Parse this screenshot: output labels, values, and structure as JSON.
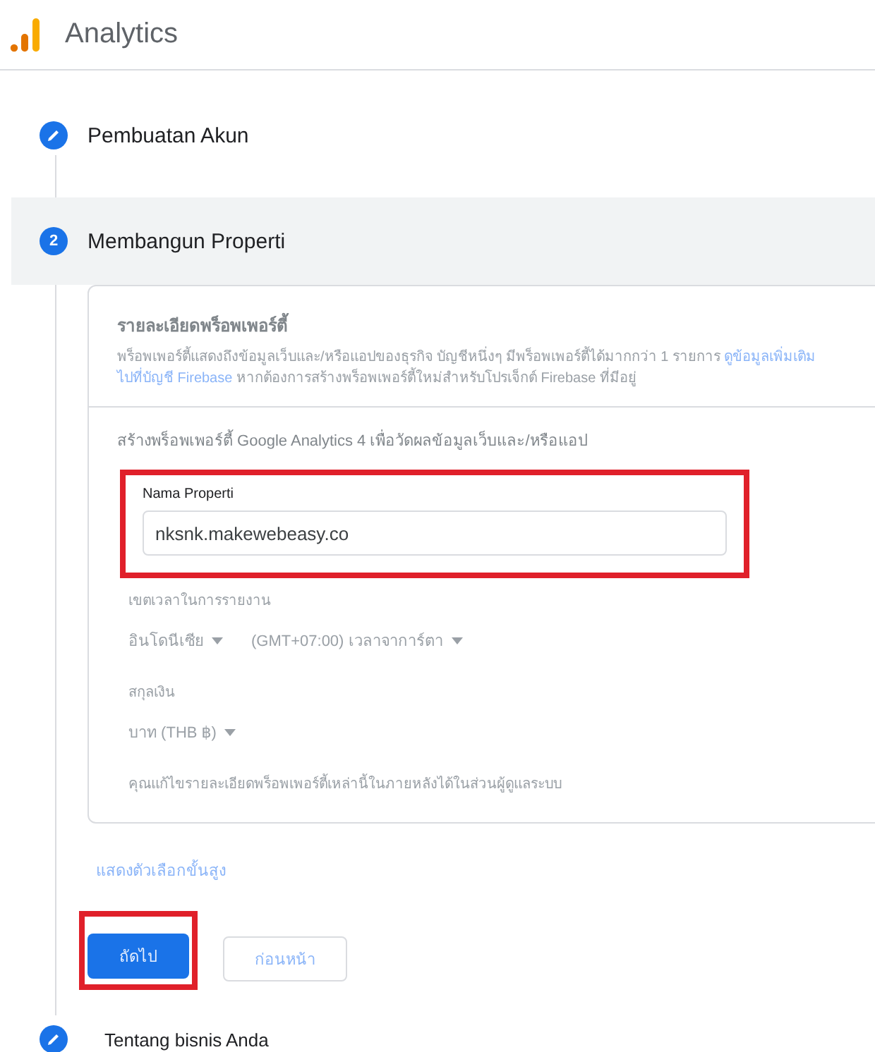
{
  "header": {
    "title": "Analytics"
  },
  "steps": [
    {
      "kind": "edit",
      "label": "Pembuatan Akun",
      "selected": false
    },
    {
      "kind": "number",
      "number": "2",
      "label": "Membangun Properti",
      "selected": true
    },
    {
      "kind": "edit",
      "label": "Tentang bisnis Anda",
      "selected": false
    }
  ],
  "property_details": {
    "title": "รายละเอียดพร็อพเพอร์ตี้",
    "text": "พร็อพเพอร์ตี้แสดงถึงข้อมูลเว็บและ/หรือแอปของธุรกิจ บัญชีหนึ่งๆ มีพร็อพเพอร์ตี้ได้มากกว่า 1 รายการ",
    "link": "ดูข้อมูลเพิ่มเติม",
    "link_2": "ไปที่บัญชี Firebase",
    "text_2": "หากต้องการสร้างพร็อพเพอร์ตี้ใหม่สำหรับโปรเจ็กต์ Firebase ที่มีอยู่"
  },
  "create": {
    "title": "สร้างพร็อพเพอร์ตี้ Google Analytics 4 เพื่อวัดผลข้อมูลเว็บและ/หรือแอป",
    "property_name": {
      "label": "Nama Properti",
      "value": "nksnk.makewebeasy.co",
      "highlighted": true
    },
    "timezone": {
      "label": "เขตเวลาในการรายงาน",
      "country": "อินโดนีเซีย",
      "zone": "(GMT+07:00) เวลาจาการ์ตา"
    },
    "currency": {
      "label": "สกุลเงิน",
      "value": "บาท (THB ฿)"
    },
    "note": "คุณแก้ไขรายละเอียดพร็อพเพอร์ตี้เหล่านี้ในภายหลังได้ในส่วนผู้ดูแลระบบ"
  },
  "advanced_link": "แสดงตัวเลือกขั้นสูง",
  "buttons": [
    {
      "kind": "primary",
      "label": "ถัดไป",
      "highlighted": true
    },
    {
      "kind": "secondary",
      "label": "ก่อนหน้า",
      "highlighted": false
    }
  ]
}
